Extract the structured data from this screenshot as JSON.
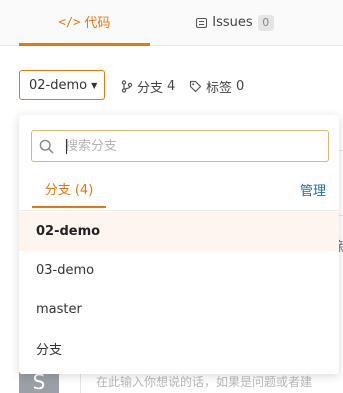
{
  "tabs": {
    "code": {
      "icon": "code-icon",
      "glyph": "</>",
      "label": "代码"
    },
    "issues": {
      "icon": "issues-icon",
      "label": "Issues",
      "count": "0"
    }
  },
  "repo_bar": {
    "branch_selector": {
      "value": "02-demo",
      "caret_icon": "caret-down-icon"
    },
    "branches_stat": {
      "icon": "branch-icon",
      "label": "分支",
      "count": "4"
    },
    "tags_stat": {
      "icon": "tag-icon",
      "label": "标签",
      "count": "0"
    }
  },
  "dropdown": {
    "search": {
      "placeholder": "搜索分支",
      "value": "",
      "icon": "search-icon"
    },
    "tab_label": "分支 (4)",
    "manage_label": "管理",
    "items": [
      {
        "label": "02-demo",
        "selected": true
      },
      {
        "label": "03-demo",
        "selected": false
      },
      {
        "label": "master",
        "selected": false
      },
      {
        "label": "分支",
        "selected": false
      }
    ]
  },
  "background": {
    "avatar_letter": "S",
    "comment_placeholder": "在此输入你想说的话，如果是问题或者建",
    "partial_right_text": "新"
  },
  "colors": {
    "accent": "#e8760c",
    "link": "#1a6fa8",
    "selected_row": "#fdf5ee"
  }
}
